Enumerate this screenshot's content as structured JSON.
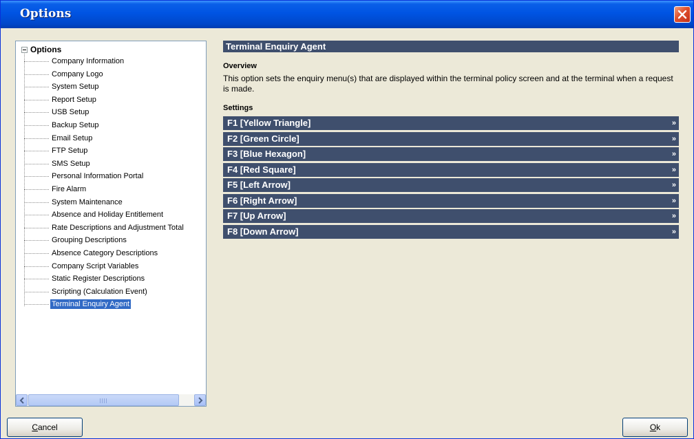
{
  "window": {
    "title": "Options"
  },
  "tree": {
    "root_label": "Options",
    "items": [
      "Company Information",
      "Company Logo",
      "System Setup",
      "Report Setup",
      "USB Setup",
      "Backup Setup",
      "Email Setup",
      "FTP Setup",
      "SMS Setup",
      "Personal Information Portal",
      "Fire Alarm",
      "System Maintenance",
      "Absence and Holiday Entitlement",
      "Rate Descriptions and Adjustment Total",
      "Grouping Descriptions",
      "Absence Category Descriptions",
      "Company Script Variables",
      "Static Register Descriptions",
      "Scripting (Calculation Event)",
      "Terminal Enquiry Agent"
    ],
    "selected_item": "Terminal Enquiry Agent"
  },
  "panel": {
    "header": "Terminal Enquiry Agent",
    "overview_label": "Overview",
    "overview_text": "This option sets the enquiry menu(s) that are displayed within the terminal policy screen and at the terminal when a request is made.",
    "settings_label": "Settings",
    "expand_glyph": "»",
    "settings": [
      "F1 [Yellow Triangle]",
      "F2 [Green Circle]",
      "F3 [Blue Hexagon]",
      "F4 [Red Square]",
      "F5 [Left Arrow]",
      "F6 [Right Arrow]",
      "F7 [Up Arrow]",
      "F8 [Down Arrow]"
    ]
  },
  "buttons": {
    "cancel": {
      "mnemonic": "C",
      "rest": "ancel"
    },
    "ok": {
      "mnemonic": "O",
      "rest": "k"
    }
  },
  "colors": {
    "title_bar": "#0054e3",
    "section_bar": "#3f4f6d",
    "selection": "#316ac5",
    "dialog_bg": "#ece9d8"
  }
}
